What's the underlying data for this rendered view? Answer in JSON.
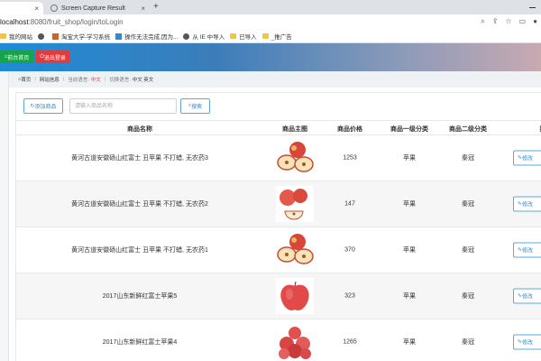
{
  "browser": {
    "tabs": [
      {
        "label": "",
        "active": true
      },
      {
        "label": "Screen Capture Result",
        "active": false
      }
    ],
    "url_host": "localhost",
    "url_path": ":8080/fruit_shop/login/toLogin",
    "bookmarks": [
      {
        "label": "我的网站",
        "icon": "folder-icon"
      },
      {
        "label": "",
        "icon": "globe-icon"
      },
      {
        "label": "淘宝大学-学习系统",
        "icon": "taobao-icon"
      },
      {
        "label": "操作无法完成,因为...",
        "icon": "site-icon"
      },
      {
        "label": "从 IE 中导入",
        "icon": "globe-icon"
      },
      {
        "label": "已导入",
        "icon": "folder-icon"
      },
      {
        "label": "_推广告",
        "icon": "folder-icon"
      }
    ]
  },
  "header": {
    "home_label": "前台首页",
    "logout_label": "退出登录"
  },
  "breadcrumb": {
    "home": "首页",
    "section": "网站信息",
    "current_lang_label": "当前语言:",
    "current_lang": "中文",
    "switch_lang_label": "切换语言:",
    "lang_options": "中文 英文"
  },
  "toolbar": {
    "add_label": "添加商品",
    "search_placeholder": "请输入商品名称",
    "search_label": "搜索"
  },
  "table": {
    "headers": {
      "name": "商品名称",
      "image": "商品主图",
      "price": "商品价格",
      "cat1": "商品一级分类",
      "cat2": "商品二级分类",
      "action": "操"
    },
    "edit_label": "修改",
    "rows": [
      {
        "name": "黄河古道安徽砀山红富士 丑苹果 不打蜡, 无农药3",
        "price": "1253",
        "cat1": "苹果",
        "cat2": "秦冠",
        "image": "halved-apples"
      },
      {
        "name": "黄河古道安徽砀山红富士 丑苹果 不打蜡, 无农药2",
        "price": "147",
        "cat1": "苹果",
        "cat2": "秦冠",
        "image": "apple-slice"
      },
      {
        "name": "黄河古道安徽砀山红富士 丑苹果 不打蜡, 无农药1",
        "price": "370",
        "cat1": "苹果",
        "cat2": "秦冠",
        "image": "halved-apples"
      },
      {
        "name": "2017山东新鲜红富士苹果5",
        "price": "323",
        "cat1": "苹果",
        "cat2": "秦冠",
        "image": "single-apple"
      },
      {
        "name": "2017山东新鲜红富士苹果4",
        "price": "1265",
        "cat1": "苹果",
        "cat2": "秦冠",
        "image": "apple-pile"
      }
    ]
  },
  "colors": {
    "home_button": "#18a34a",
    "logout_button": "#e23b3b",
    "accent": "#3a8cc7"
  }
}
